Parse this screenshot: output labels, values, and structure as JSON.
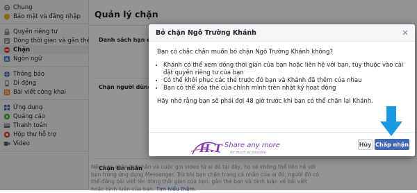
{
  "sidebar": {
    "groups": [
      [
        {
          "label": "Chung",
          "icon": "gear-icon"
        },
        {
          "label": "Bảo mật và đăng nhập",
          "icon": "badge-icon"
        }
      ],
      [
        {
          "label": "Quyền riêng tư",
          "icon": "lock-icon"
        },
        {
          "label": "Dòng thời gian và gắn thẻ",
          "icon": "timeline-icon"
        },
        {
          "label": "Chặn",
          "icon": "block-icon",
          "active": true
        },
        {
          "label": "Ngôn ngữ",
          "icon": "language-icon"
        }
      ],
      [
        {
          "label": "Thông báo",
          "icon": "globe-icon"
        },
        {
          "label": "Di động",
          "icon": "mobile-icon"
        },
        {
          "label": "Bài viết công khai",
          "icon": "rss-icon"
        }
      ],
      [
        {
          "label": "Ứng dụng",
          "icon": "apps-icon"
        },
        {
          "label": "Quảng cáo",
          "icon": "ads-icon"
        },
        {
          "label": "Thanh toán",
          "icon": "payment-icon"
        },
        {
          "label": "Hộp thư hỗ trợ",
          "icon": "support-inbox-icon"
        },
        {
          "label": "Video",
          "icon": "video-icon"
        }
      ]
    ]
  },
  "main": {
    "title": "Quản lý chặn",
    "sections": {
      "restricted": "Danh sách hạn chế",
      "block_users": "Chặn người dùng",
      "block_messages": "Chặn tin nhắn"
    },
    "bottom_text_1": "Nếu bạn chặn tin nhắn và cuộc gọi video từ ai đó tại đây, họ sẽ không thể liên hệ với bạn trong ứng dụng Messenger. Trừ khi bạn chặn trang cá nhân của ai đó, người đó có thể đăng bài viết lên dòng thời gian của bạn, gắn thẻ bạn và bình luận về bài viết hoặc bình luận của bạn.",
    "bottom_link": "Tìm hiểu thêm."
  },
  "dialog": {
    "title": "Bỏ chặn Ngô Trường Khánh",
    "question": "Bạn có chắc chắn muốn bỏ chặn Ngô Trường Khánh không?",
    "bullets": [
      "Khánh có thể xem dòng thời gian của bạn hoặc liên hệ với bạn, tùy thuộc vào cài đặt quyền riêng tư của bạn",
      "Có thể khôi phục các thẻ trước đó bạn và Khánh đã thêm của nhau",
      "Bạn có thể xóa thẻ của chính mình trên nhật ký hoạt động"
    ],
    "note": "Hãy nhớ rằng bạn sẽ phải đợi 48 giờ trước khi bạn có thể chặn lại Khánh.",
    "cancel_label": "Hủy",
    "confirm_label": "Chấp nhận",
    "close_glyph": "×"
  },
  "watermark": {
    "logo_text": "H.T",
    "tagline": "Share any more",
    "subtagline": "for much as possible"
  },
  "colors": {
    "brand_blue": "#4267b2",
    "arrow_blue": "#1a9ae0",
    "logo_purple": "#7b3fb0"
  }
}
